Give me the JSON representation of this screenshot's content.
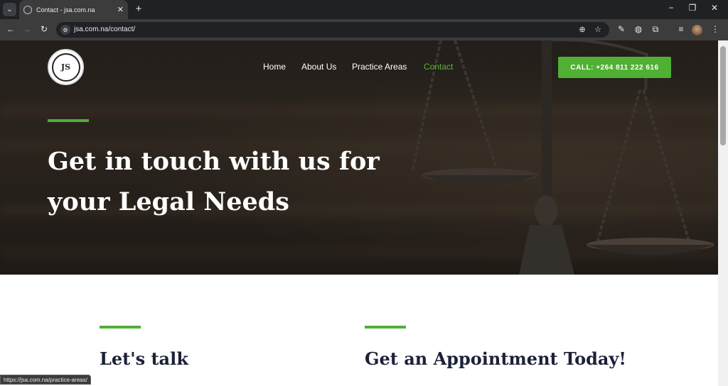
{
  "browser": {
    "tab_title": "Contact - jsa.com.na",
    "url": "jsa.com.na/contact/",
    "status_url": "https://jsa.com.na/practice-areas/"
  },
  "site": {
    "logo_text": "JS",
    "nav": [
      {
        "label": "Home",
        "active": false
      },
      {
        "label": "About Us",
        "active": false
      },
      {
        "label": "Practice Areas",
        "active": false
      },
      {
        "label": "Contact",
        "active": true
      }
    ],
    "call_button": "CALL: +264 811 222 616",
    "hero_title": "Get in touch with us for your Legal Needs",
    "sections": {
      "left_title": "Let's talk",
      "right_title": "Get an Appointment Today!"
    }
  },
  "colors": {
    "accent": "#4fb034",
    "active_nav": "#5db33a",
    "heading_dark": "#1b2237"
  },
  "icons": {
    "back": "arrow-left-icon",
    "forward": "arrow-right-icon",
    "reload": "reload-icon",
    "zoom": "zoom-icon",
    "bookmark": "star-icon"
  }
}
